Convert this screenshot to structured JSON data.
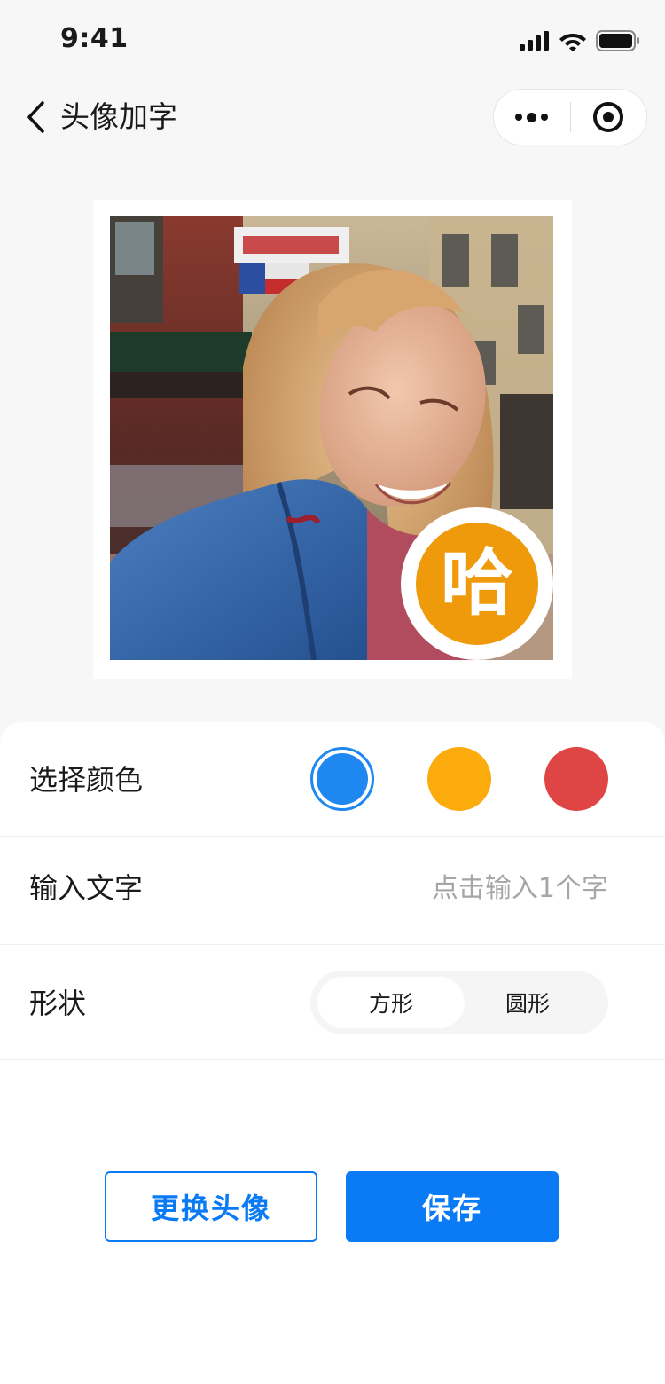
{
  "status_bar": {
    "time": "9:41",
    "icons": [
      "signal-icon",
      "wifi-icon",
      "battery-icon"
    ]
  },
  "nav": {
    "back_icon": "chevron-left-icon",
    "title": "头像加字",
    "capsule_icons": [
      "more-dots-icon",
      "close-target-icon"
    ]
  },
  "avatar": {
    "badge_text": "哈",
    "badge_color": "#ef9a0b"
  },
  "settings": {
    "color": {
      "label": "选择颜色",
      "options": [
        "#1e87f0",
        "#fbab0b",
        "#e04545"
      ],
      "selected": "#1e87f0"
    },
    "text": {
      "label": "输入文字",
      "placeholder": "点击输入1个字"
    },
    "shape": {
      "label": "形状",
      "options": [
        "方形",
        "圆形"
      ],
      "selected": "方形"
    }
  },
  "buttons": {
    "change_avatar": "更换头像",
    "save": "保存"
  },
  "colors": {
    "primary": "#0a7bf4",
    "background": "#f7f7f7"
  }
}
